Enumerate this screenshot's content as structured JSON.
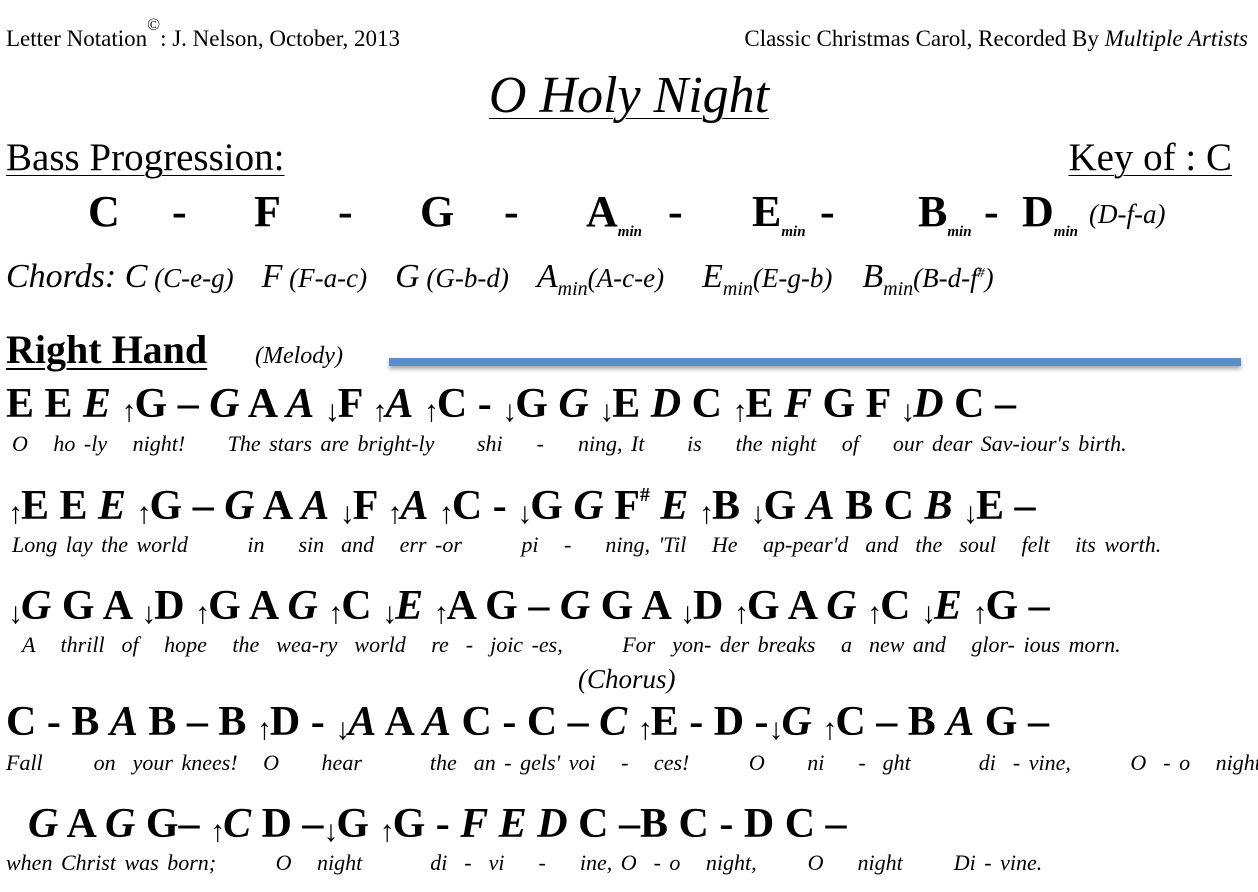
{
  "header": {
    "left_prefix": "Letter Notation",
    "copyright": "©",
    "left_suffix": ": J. Nelson, October, 2013",
    "right_plain": "Classic Christmas Carol, Recorded By ",
    "right_italic": "Multiple Artists"
  },
  "title": "O Holy Night",
  "bass_heading": "Bass Progression:",
  "key_label": "Key of :  C",
  "bass_progression": [
    {
      "note": "C",
      "sub": ""
    },
    {
      "note": "F",
      "sub": ""
    },
    {
      "note": "G",
      "sub": ""
    },
    {
      "note": "A",
      "sub": "min"
    },
    {
      "note": "E",
      "sub": "min"
    },
    {
      "note": "B",
      "sub": "min"
    },
    {
      "note": "D",
      "sub": "min",
      "triad": "(D-f-a)"
    }
  ],
  "separator": "-",
  "chords_label": "Chords:",
  "chords": [
    {
      "name": "C",
      "sub": "",
      "triad": "(C-e-g)"
    },
    {
      "name": "F",
      "sub": "",
      "triad": "(F-a-c)"
    },
    {
      "name": "G",
      "sub": "",
      "triad": "(G-b-d)"
    },
    {
      "name": "A",
      "sub": "min",
      "triad": "(A-c-e)"
    },
    {
      "name": "E",
      "sub": "min",
      "triad": "(E-g-b)"
    },
    {
      "name": "B",
      "sub": "min",
      "triad": "(B-d-f",
      "sharp": "#",
      "close": ")"
    }
  ],
  "right_hand_heading": "Right Hand",
  "melody_label": "(Melody)",
  "accent_color": "#5b8ec9",
  "lines": [
    {
      "notes": "E E |E| ↑G – |G| A |A| ↓F ↑|A| ↑C - ↓G |G| ↓E |D| C ↑E |F| G F ↓|D| C –",
      "lyrics": "O   ho -ly   night!     The stars are bright-ly     shi    -    ning, It     is    the night   of    our dear Sav-iour's birth."
    },
    {
      "notes": "↑E E |E| ↑G – |G| A |A| ↓F ↑|A| ↑C - ↓G |G| F# |E| ↑B ↓G |A| B C |B| ↓E –",
      "lyrics": "Long lay the world       in    sin  and   err -or       pi   -    ning, 'Til   He   ap-pear'd  and  the  soul   felt   its worth."
    },
    {
      "notes": "↓|G| G A ↓D ↑G A |G| ↑C ↓|E| ↑A G – |G| G A ↓D ↑G A |G| ↑C ↓|E| ↑G –",
      "lyrics": "A   thrill  of   hope   the  wea-ry  world   re  -  joic -es,       For  yon- der breaks   a  new and   glor- ious morn."
    },
    {
      "notes": "C - B |A| B – B ↑D - ↓|A| A |A| C - C – |C| ↑E - D -↓|G| ↑C – B |A| G –",
      "lyrics": "Fall      on  your knees!   O     hear        the  an - gels' voi   -   ces!       O     ni    -  ght        di  - vine,       O  - o   night"
    },
    {
      "notes": "|G| A |G| G– ↑|C| D –↓G ↑G - |F| |E| |D| C –B C - D C –",
      "lyrics": "when Christ was born;       O   night        di  -  vi    -    ine, O  - o   night,      O    night      Di - vine."
    }
  ],
  "chorus_label": "(Chorus)"
}
